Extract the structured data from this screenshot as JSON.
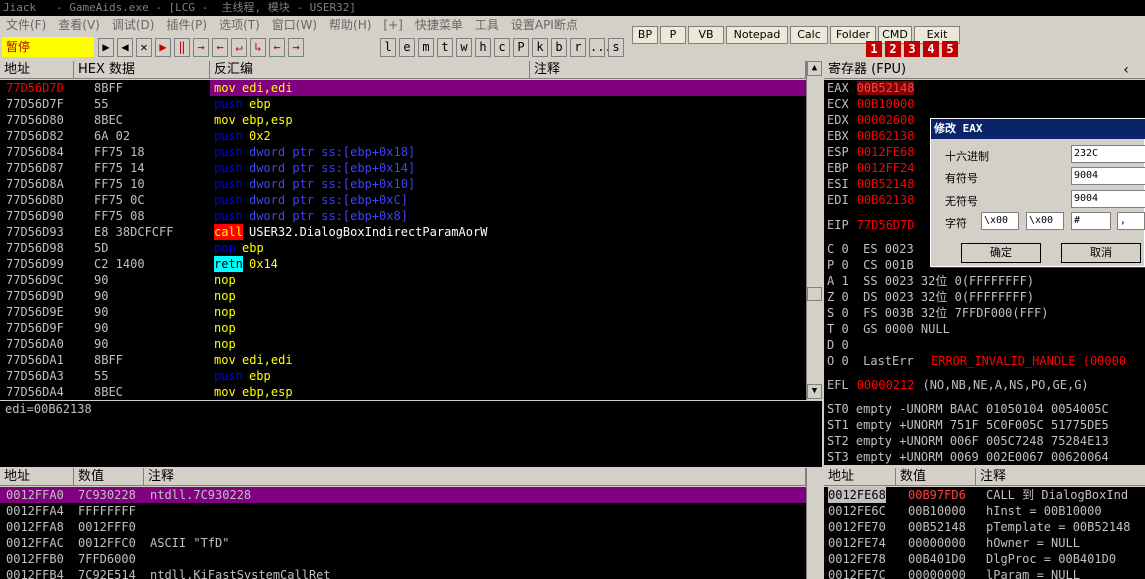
{
  "window": {
    "title": "Jiack   - GameAids.exe - [LCG -  主线程, 模块 - USER32]"
  },
  "menu": [
    "文件(F)",
    "查看(V)",
    "调试(D)",
    "插件(P)",
    "选项(T)",
    "窗口(W)",
    "帮助(H)",
    "[+]",
    "快捷菜单",
    "工具",
    "设置API断点"
  ],
  "toolbar": {
    "status": "暂停",
    "icons": [
      "▶",
      "◀",
      "✕",
      "▶",
      "‖",
      "→",
      "←",
      "↵",
      "↳",
      "←",
      "→"
    ],
    "letters": [
      "l",
      "e",
      "m",
      "t",
      "w",
      "h",
      "c",
      "P",
      "k",
      "b",
      "r",
      "...",
      "s"
    ],
    "buttons": [
      "BP",
      "P",
      "VB",
      "Notepad",
      "Calc",
      "Folder",
      "CMD",
      "Exit"
    ],
    "nums": [
      "1",
      "2",
      "3",
      "4",
      "5"
    ]
  },
  "cpu": {
    "headers": [
      "地址",
      "HEX 数据",
      "反汇编",
      "注释"
    ],
    "rows": [
      {
        "addr": "77D56D7D",
        "hex": "8BFF",
        "mn": "mov",
        "op": "edi,edi",
        "sel": true,
        "cls": "kw-yel"
      },
      {
        "addr": "77D56D7F",
        "hex": "55",
        "mn": "push",
        "op": "ebp",
        "cls": "kw-blue"
      },
      {
        "addr": "77D56D80",
        "hex": "8BEC",
        "mn": "mov",
        "op": "ebp,esp",
        "cls": "kw-yel"
      },
      {
        "addr": "77D56D82",
        "hex": "6A 02",
        "mn": "push",
        "op": "0x2",
        "cls": "kw-blue"
      },
      {
        "addr": "77D56D84",
        "hex": "FF75 18",
        "mn": "push",
        "op": "dword ptr ss:[ebp+0x18]",
        "cls": "kw-blue"
      },
      {
        "addr": "77D56D87",
        "hex": "FF75 14",
        "mn": "push",
        "op": "dword ptr ss:[ebp+0x14]",
        "cls": "kw-blue"
      },
      {
        "addr": "77D56D8A",
        "hex": "FF75 10",
        "mn": "push",
        "op": "dword ptr ss:[ebp+0x10]",
        "cls": "kw-blue"
      },
      {
        "addr": "77D56D8D",
        "hex": "FF75 0C",
        "mn": "push",
        "op": "dword ptr ss:[ebp+0xC]",
        "cls": "kw-blue"
      },
      {
        "addr": "77D56D90",
        "hex": "FF75 08",
        "mn": "push",
        "op": "dword ptr ss:[ebp+0x8]",
        "cls": "kw-blue"
      },
      {
        "addr": "77D56D93",
        "hex": "E8 38DCFCFF",
        "mn": "call",
        "op": "USER32.DialogBoxIndirectParamAorW",
        "cls": "kw-call"
      },
      {
        "addr": "77D56D98",
        "hex": "5D",
        "mn": "pop",
        "op": "ebp",
        "cls": "kw-blue"
      },
      {
        "addr": "77D56D99",
        "hex": "C2 1400",
        "mn": "retn",
        "op": "0x14",
        "cls": "kw-retn"
      },
      {
        "addr": "77D56D9C",
        "hex": "90",
        "mn": "nop",
        "op": "",
        "cls": "kw-yel"
      },
      {
        "addr": "77D56D9D",
        "hex": "90",
        "mn": "nop",
        "op": "",
        "cls": "kw-yel"
      },
      {
        "addr": "77D56D9E",
        "hex": "90",
        "mn": "nop",
        "op": "",
        "cls": "kw-yel"
      },
      {
        "addr": "77D56D9F",
        "hex": "90",
        "mn": "nop",
        "op": "",
        "cls": "kw-yel"
      },
      {
        "addr": "77D56DA0",
        "hex": "90",
        "mn": "nop",
        "op": "",
        "cls": "kw-yel"
      },
      {
        "addr": "77D56DA1",
        "hex": "8BFF",
        "mn": "mov",
        "op": "edi,edi",
        "cls": "kw-yel"
      },
      {
        "addr": "77D56DA3",
        "hex": "55",
        "mn": "push",
        "op": "ebp",
        "cls": "kw-blue"
      },
      {
        "addr": "77D56DA4",
        "hex": "8BEC",
        "mn": "mov",
        "op": "ebp,esp",
        "cls": "kw-yel"
      }
    ],
    "info": "edi=00B62138"
  },
  "registers": {
    "title": "寄存器 (FPU)",
    "regs": [
      {
        "n": "EAX",
        "v": "00B52148",
        "hl": true
      },
      {
        "n": "ECX",
        "v": "00B10000"
      },
      {
        "n": "EDX",
        "v": "00002600"
      },
      {
        "n": "EBX",
        "v": "00B62138"
      },
      {
        "n": "ESP",
        "v": "0012FE68"
      },
      {
        "n": "EBP",
        "v": "0012FF24"
      },
      {
        "n": "ESI",
        "v": "00B52148"
      },
      {
        "n": "EDI",
        "v": "00B62138"
      }
    ],
    "eip": {
      "n": "EIP",
      "v": "77D56D7D"
    },
    "flags": [
      "C 0  ES 0023",
      "P 0  CS 001B",
      "A 1  SS 0023 32位 0(FFFFFFFF)",
      "Z 0  DS 0023 32位 0(FFFFFFFF)",
      "S 0  FS 003B 32位 7FFDF000(FFF)",
      "T 0  GS 0000 NULL",
      "D 0",
      "O 0  LastErr"
    ],
    "lasterr": "ERROR_INVALID_HANDLE (00000",
    "efl": "EFL",
    "eflv": "00000212",
    "eflt": "(NO,NB,NE,A,NS,PO,GE,G)",
    "st": [
      "ST0 empty -UNORM BAAC 01050104 0054005C",
      "ST1 empty +UNORM 751F 5C0F005C 51775DE5",
      "ST2 empty +UNORM 006F 005C7248 75284E13",
      "ST3 empty +UNORM 0069 002E0067 00620064"
    ]
  },
  "dialog": {
    "title": "修改 EAX",
    "labels": [
      "十六进制",
      "有符号",
      "无符号",
      "字符"
    ],
    "values": [
      "232C",
      "9004",
      "9004"
    ],
    "chars": [
      "\\x00",
      "\\x00",
      "#",
      ","
    ],
    "ok": "确定",
    "cancel": "取消"
  },
  "dump": {
    "headers": [
      "地址",
      "数值",
      "注释"
    ],
    "rows": [
      {
        "a": "0012FFA0",
        "v": "7C930228",
        "c": "ntdll.7C930228",
        "sel": true
      },
      {
        "a": "0012FFA4",
        "v": "FFFFFFFF",
        "c": ""
      },
      {
        "a": "0012FFA8",
        "v": "0012FFF0",
        "c": ""
      },
      {
        "a": "0012FFAC",
        "v": "0012FFC0",
        "c": "ASCII \"TfD\""
      },
      {
        "a": "0012FFB0",
        "v": "7FFD6000",
        "c": ""
      },
      {
        "a": "0012FFB4",
        "v": "7C92E514",
        "c": "ntdll.KiFastSystemCallRet"
      }
    ]
  },
  "stack": {
    "headers": [
      "地址",
      "数值",
      "注释"
    ],
    "rows": [
      {
        "a": "0012FE68",
        "v": "00B97FD6",
        "c": "CALL 到 DialogBoxInd",
        "sel": true
      },
      {
        "a": "0012FE6C",
        "v": "00B10000",
        "c": "hInst = 00B10000"
      },
      {
        "a": "0012FE70",
        "v": "00B52148",
        "c": "pTemplate = 00B52148"
      },
      {
        "a": "0012FE74",
        "v": "00000000",
        "c": "hOwner = NULL"
      },
      {
        "a": "0012FE78",
        "v": "00B401D0",
        "c": "DlgProc = 00B401D0"
      },
      {
        "a": "0012FE7C",
        "v": "00000000",
        "c": "lParam = NULL"
      }
    ]
  }
}
